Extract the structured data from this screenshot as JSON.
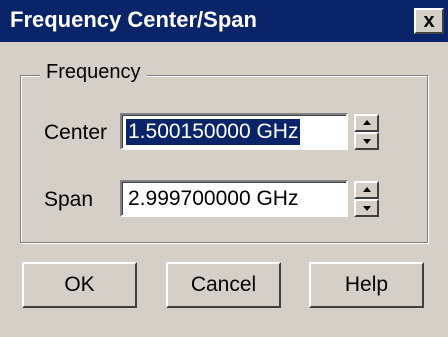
{
  "window": {
    "title": "Frequency Center/Span",
    "close_label": "x"
  },
  "group": {
    "label": "Frequency"
  },
  "fields": {
    "center": {
      "label": "Center",
      "value": "1.500150000 GHz",
      "selected": true
    },
    "span": {
      "label": "Span",
      "value": "2.999700000 GHz",
      "selected": false
    }
  },
  "buttons": {
    "ok": "OK",
    "cancel": "Cancel",
    "help": "Help"
  },
  "colors": {
    "titlebar": "#0a246a",
    "face": "#d4d0c8",
    "selection": "#0a246a"
  }
}
